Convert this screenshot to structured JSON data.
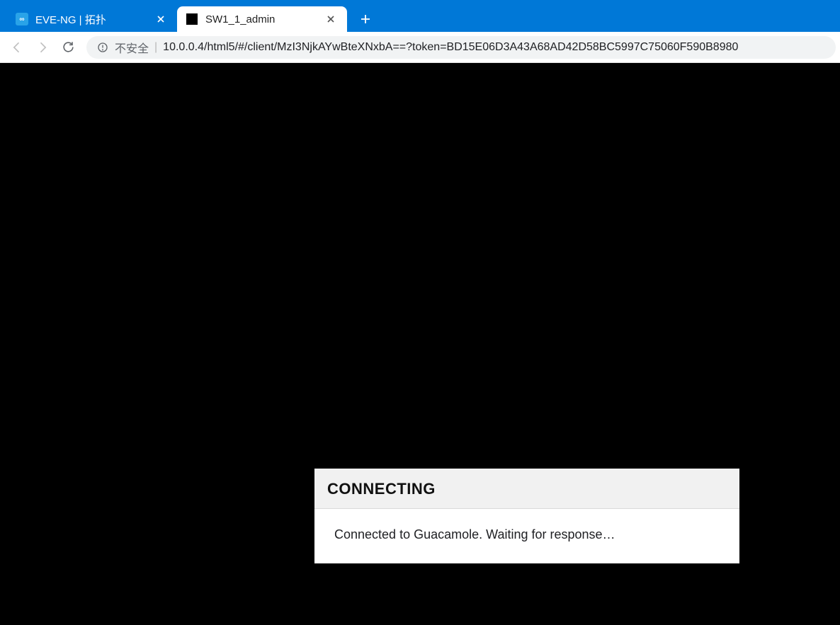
{
  "tabs": [
    {
      "title": "EVE-NG | 拓扑",
      "active": false
    },
    {
      "title": "SW1_1_admin",
      "active": true
    }
  ],
  "address": {
    "security_label": "不安全",
    "separator": "|",
    "url": "10.0.0.4/html5/#/client/MzI3NjkAYwBteXNxbA==?token=BD15E06D3A43A68AD42D58BC5997C75060F590B8980"
  },
  "dialog": {
    "title": "CONNECTING",
    "message": "Connected to Guacamole. Waiting for response…"
  }
}
